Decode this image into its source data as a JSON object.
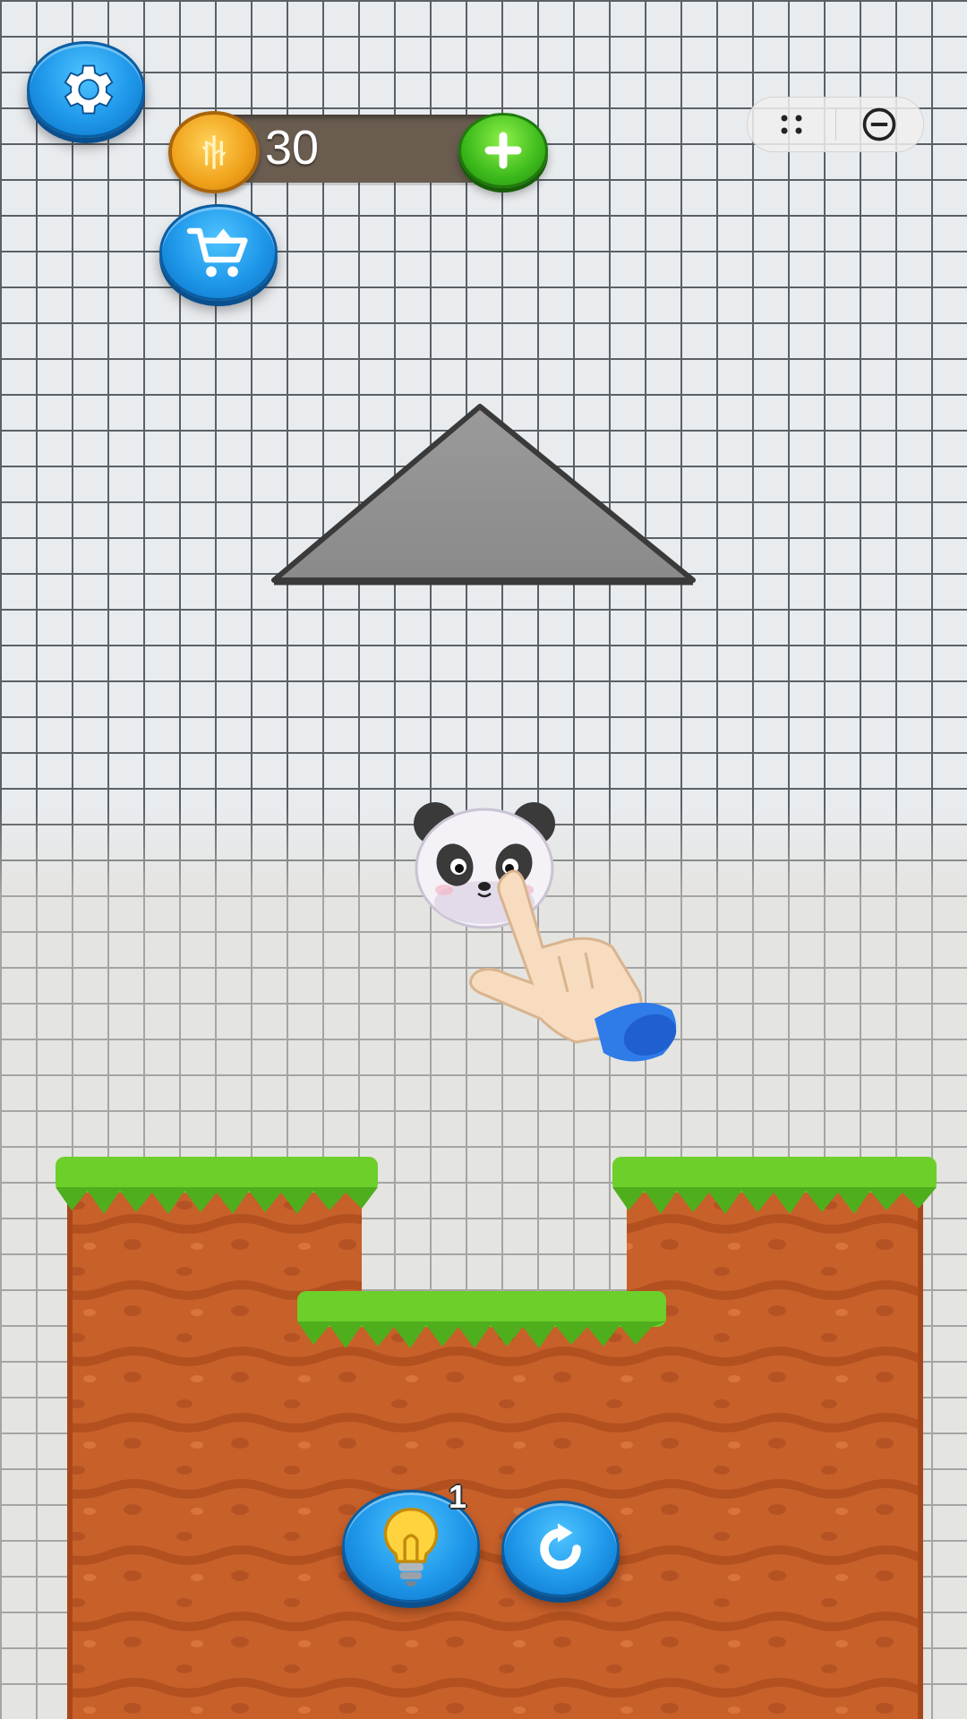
{
  "hud": {
    "settings_icon": "gear-icon",
    "coins": {
      "value": "30",
      "icon": "bamboo-coin-icon",
      "add_icon": "plus-icon"
    },
    "shop_icon": "shopping-cart-icon"
  },
  "capsule": {
    "more_icon": "dots-icon",
    "close_icon": "minus-circle-icon"
  },
  "level": {
    "obstacle": "triangle",
    "character": "panda",
    "tutorial_icon": "tap-hand-icon"
  },
  "footer": {
    "hint": {
      "icon": "lightbulb-icon",
      "count": "1"
    },
    "restart_icon": "restart-icon"
  },
  "colors": {
    "button_blue": "#1f98ea",
    "coin_bar": "#6a5d50",
    "add_green": "#3dbb1c",
    "grass": "#6ccf2a",
    "dirt": "#c8602a",
    "grid_line": "#5b6066"
  }
}
